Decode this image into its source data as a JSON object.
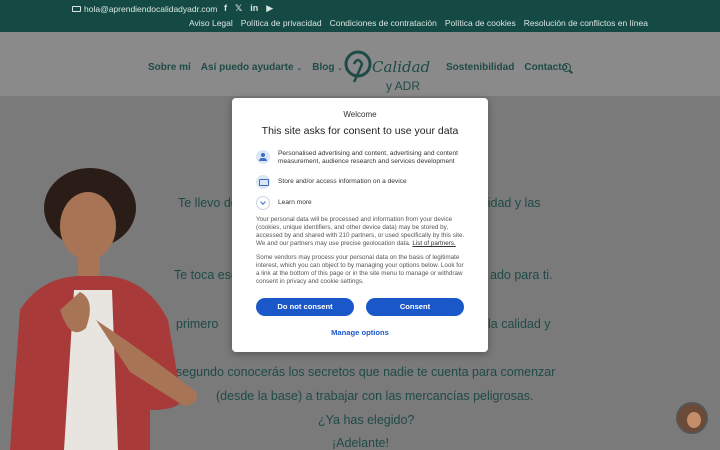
{
  "topbar": {
    "email": "hola@aprendiendocalidadyadr.com",
    "socials": [
      "facebook-icon",
      "x-icon",
      "linkedin-icon",
      "youtube-icon"
    ],
    "legal_links": [
      "Aviso Legal",
      "Política de privacidad",
      "Condiciones de contratación",
      "Política de cookies",
      "Resolución de conflictos en línea"
    ]
  },
  "nav": {
    "left": [
      {
        "label": "Sobre mí",
        "dropdown": false
      },
      {
        "label": "Así puedo ayudarte",
        "dropdown": true
      },
      {
        "label": "Blog",
        "dropdown": true
      }
    ],
    "right": [
      {
        "label": "Sostenibilidad"
      },
      {
        "label": "Contacto"
      }
    ],
    "logo": {
      "line1": "Calidad",
      "line2": "y ADR"
    }
  },
  "page": {
    "line1_left": "Te llevo de",
    "line1_right": "alidad y las",
    "line2_left": "Te toca esco",
    "line2_right": "ado para ti.",
    "line3_left": "primero",
    "line3_right": "la calidad y",
    "line4": "segundo conocerás los secretos que nadie te cuenta para comenzar",
    "line5": "(desde la base) a trabajar con las mercancías peligrosas.",
    "line6": "¿Ya has elegido?",
    "line7": "¡Adelante!"
  },
  "consent": {
    "welcome": "Welcome",
    "title": "This site asks for consent to use your data",
    "purposes": [
      {
        "icon": "person-icon",
        "text": "Personalised advertising and content, advertising and content measurement, audience research and services development"
      },
      {
        "icon": "device-icon",
        "text": "Store and/or access information on a device"
      }
    ],
    "learn_more": "Learn more",
    "para1": "Your personal data will be processed and information from your device (cookies, unique identifiers, and other device data) may be stored by, accessed by and shared with 210 partners, or used specifically by this site. We and our partners may use precise geolocation data.",
    "partners_link": "List of partners.",
    "para2": "Some vendors may process your personal data on the basis of legitimate interest, which you can object to by managing your options below. Look for a link at the bottom of this page or in the site menu to manage or withdraw consent in privacy and cookie settings.",
    "do_not_consent": "Do not consent",
    "consent": "Consent",
    "manage": "Manage options"
  }
}
